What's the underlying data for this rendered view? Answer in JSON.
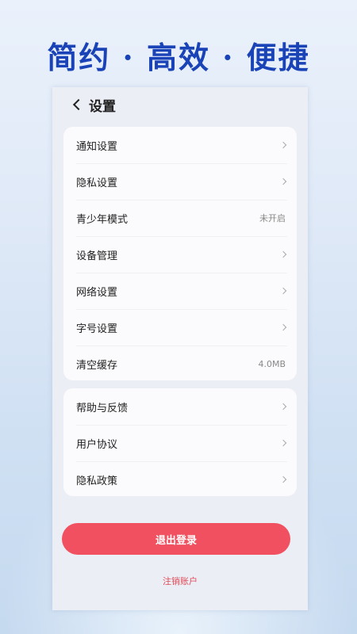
{
  "headline": "简约 · 高效 · 便捷",
  "nav": {
    "title": "设置"
  },
  "settings_group_1": [
    {
      "label": "通知设置",
      "value": ""
    },
    {
      "label": "隐私设置",
      "value": ""
    },
    {
      "label": "青少年模式",
      "value": "未开启"
    },
    {
      "label": "设备管理",
      "value": ""
    },
    {
      "label": "网络设置",
      "value": ""
    },
    {
      "label": "字号设置",
      "value": ""
    },
    {
      "label": "清空缓存",
      "value": "4.0MB"
    }
  ],
  "settings_group_2": [
    {
      "label": "帮助与反馈",
      "value": ""
    },
    {
      "label": "用户协议",
      "value": ""
    },
    {
      "label": "隐私政策",
      "value": ""
    }
  ],
  "logout_label": "退出登录",
  "cancel_account_label": "注销账户",
  "colors": {
    "headline": "#1a43b8",
    "logout_button": "#f0505f",
    "cancel_text": "#e04a58"
  }
}
